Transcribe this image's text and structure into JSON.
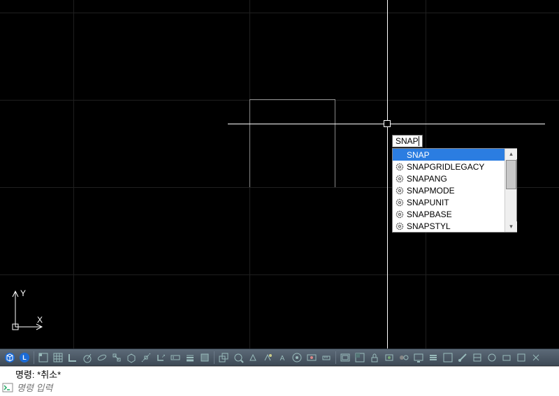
{
  "ucs": {
    "x_label": "X",
    "y_label": "Y"
  },
  "dyn_input": {
    "value": "SNAP"
  },
  "autocomplete": {
    "items": [
      {
        "label": "SNAP",
        "icon": "none",
        "selected": true
      },
      {
        "label": "SNAPGRIDLEGACY",
        "icon": "gear",
        "selected": false
      },
      {
        "label": "SNAPANG",
        "icon": "gear",
        "selected": false
      },
      {
        "label": "SNAPMODE",
        "icon": "gear",
        "selected": false
      },
      {
        "label": "SNAPUNIT",
        "icon": "gear",
        "selected": false
      },
      {
        "label": "SNAPBASE",
        "icon": "gear",
        "selected": false
      },
      {
        "label": "SNAPSTYL",
        "icon": "gear",
        "selected": false
      }
    ]
  },
  "command": {
    "history": "명령: *취소*",
    "placeholder": "명령 입력"
  },
  "colors": {
    "selection": "#2b7de1",
    "canvas": "#000000",
    "grid": "#1f1f1f"
  }
}
